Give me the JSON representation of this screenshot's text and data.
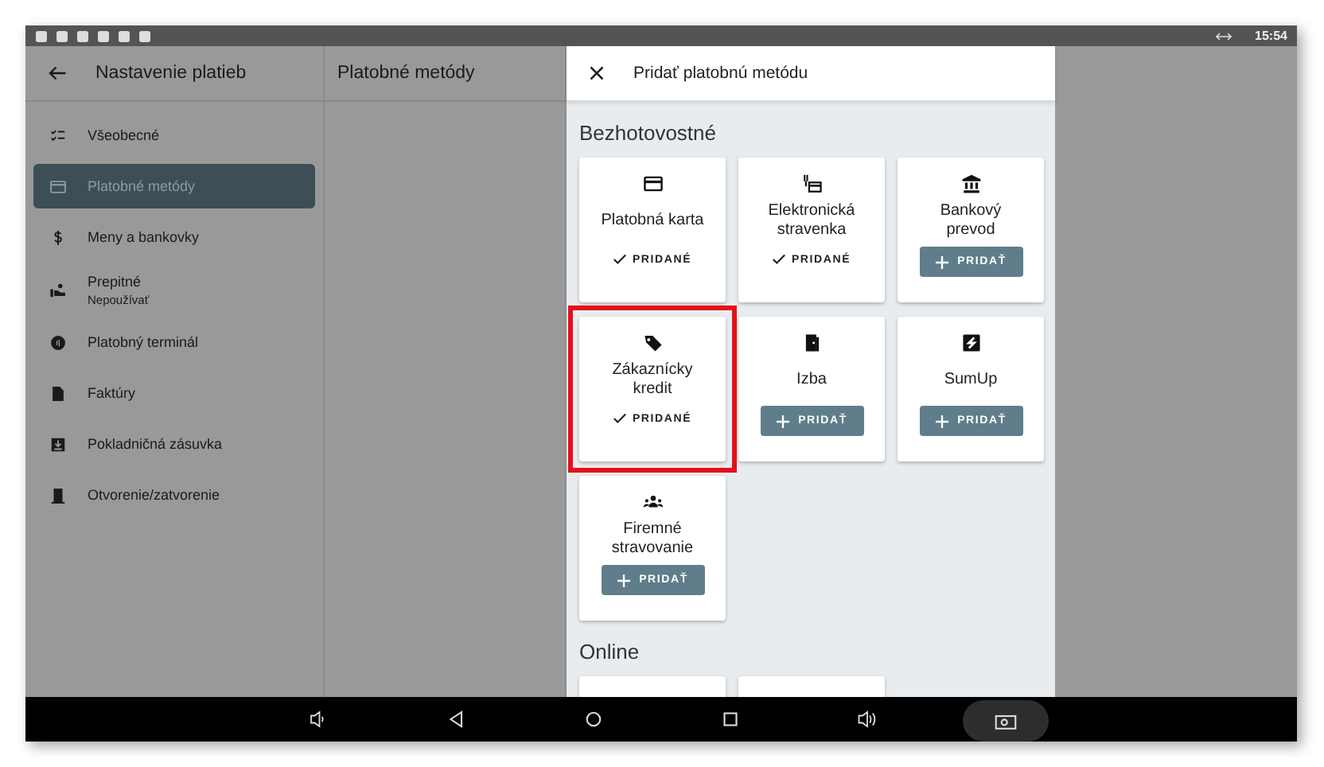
{
  "status_bar": {
    "time": "15:54"
  },
  "settings_panel": {
    "title": "Nastavenie platieb",
    "items": [
      {
        "label": "Všeobecné",
        "selected": false
      },
      {
        "label": "Platobné metódy",
        "selected": true
      },
      {
        "label": "Meny a bankovky",
        "selected": false
      },
      {
        "label": "Prepitné",
        "subtitle": "Nepoužívať",
        "selected": false
      },
      {
        "label": "Platobný terminál",
        "selected": false
      },
      {
        "label": "Faktúry",
        "selected": false
      },
      {
        "label": "Pokladničná zásuvka",
        "selected": false
      },
      {
        "label": "Otvorenie/zatvorenie",
        "selected": false
      }
    ]
  },
  "content_panel": {
    "title": "Platobné metódy"
  },
  "dialog": {
    "title": "Pridať platobnú metódu",
    "sections": [
      {
        "title": "Bezhotovostné",
        "methods": [
          {
            "name": "Platobná karta",
            "added": true,
            "action": "PRIDANÉ",
            "highlighted": false
          },
          {
            "name": "Elektronická stravenka",
            "added": true,
            "action": "PRIDANÉ",
            "highlighted": false
          },
          {
            "name": "Bankový prevod",
            "added": false,
            "action": "PRIDAŤ",
            "highlighted": false
          },
          {
            "name": "Zákaznícky kredit",
            "added": true,
            "action": "PRIDANÉ",
            "highlighted": true
          },
          {
            "name": "Izba",
            "added": false,
            "action": "PRIDAŤ",
            "highlighted": false
          },
          {
            "name": "SumUp",
            "added": false,
            "action": "PRIDAŤ",
            "highlighted": false
          },
          {
            "name": "Firemné stravovanie",
            "added": false,
            "action": "PRIDAŤ",
            "highlighted": false
          }
        ]
      },
      {
        "title": "Online"
      }
    ]
  }
}
